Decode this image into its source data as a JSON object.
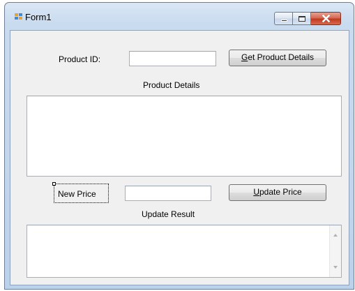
{
  "window": {
    "title": "Form1"
  },
  "colors": {
    "accent": "#0078d7",
    "close_button": "#c7402a"
  },
  "form": {
    "product_id_label": "Product ID:",
    "product_id_value": "",
    "get_details_button": {
      "accel": "G",
      "rest": "et Product Details"
    },
    "product_details_label": "Product Details",
    "product_details_value": "",
    "new_price_label": "New Price",
    "new_price_value": "",
    "update_price_button": {
      "accel": "U",
      "rest": "pdate Price"
    },
    "update_result_label": "Update Result",
    "update_result_value": ""
  },
  "icons": {
    "app": "form-app-icon",
    "minimize": "minimize-icon",
    "maximize": "maximize-icon",
    "close": "close-icon",
    "scroll_up": "scroll-up-arrow-icon",
    "scroll_down": "scroll-down-arrow-icon"
  }
}
